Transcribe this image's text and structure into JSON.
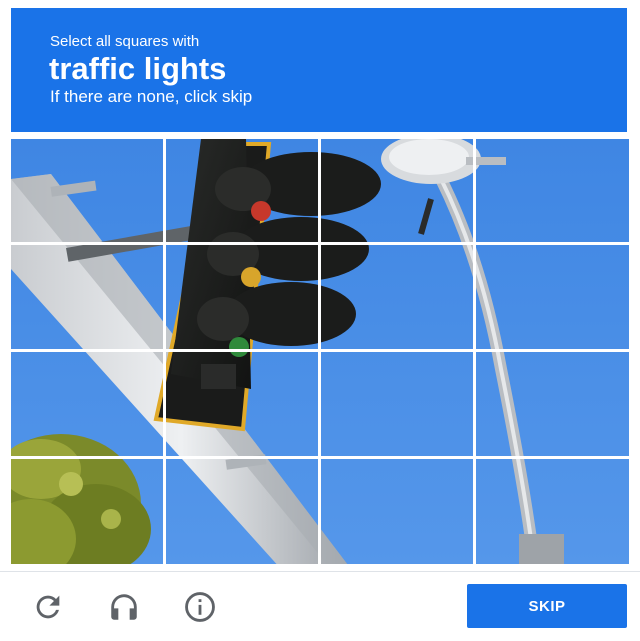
{
  "header": {
    "instruction_line": "Select all squares with",
    "target_object": "traffic lights",
    "hint": "If there are none, click skip"
  },
  "grid": {
    "rows": 4,
    "columns": 4,
    "selected": []
  },
  "footer": {
    "reload_icon": "reload-icon",
    "audio_icon": "headphones-icon",
    "info_icon": "info-icon",
    "skip_label": "SKIP"
  },
  "colors": {
    "accent": "#1a73e8",
    "sky": "#4a8fe7",
    "grid_line": "#ffffff"
  }
}
